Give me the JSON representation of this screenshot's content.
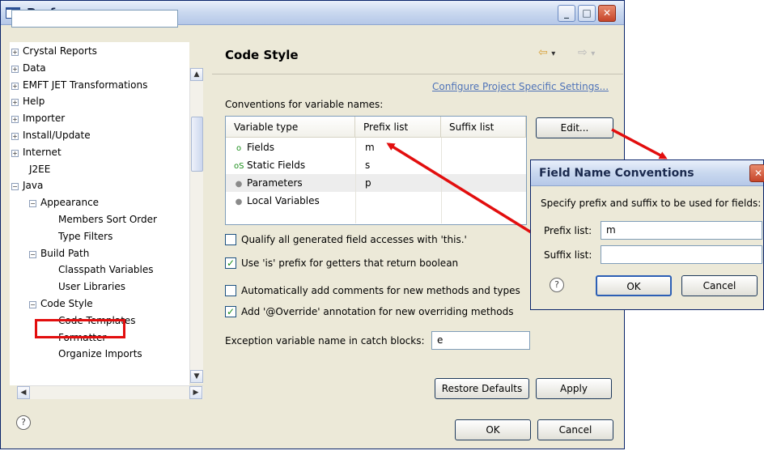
{
  "window": {
    "title": "Preferences",
    "min_label": "_",
    "max_label": "□",
    "close_label": "✕"
  },
  "tree": {
    "items": [
      {
        "label": "Crystal Reports",
        "expander": "+"
      },
      {
        "label": "Data",
        "expander": "+"
      },
      {
        "label": "EMFT JET Transformations",
        "expander": "+"
      },
      {
        "label": "Help",
        "expander": "+"
      },
      {
        "label": "Importer",
        "expander": "+"
      },
      {
        "label": "Install/Update",
        "expander": "+"
      },
      {
        "label": "Internet",
        "expander": "+"
      },
      {
        "label": "J2EE",
        "expander": ""
      },
      {
        "label": "Java",
        "expander": "−"
      },
      {
        "label": "Appearance",
        "expander": "−"
      },
      {
        "label": "Members Sort Order",
        "expander": ""
      },
      {
        "label": "Type Filters",
        "expander": ""
      },
      {
        "label": "Build Path",
        "expander": "−"
      },
      {
        "label": "Classpath Variables",
        "expander": ""
      },
      {
        "label": "User Libraries",
        "expander": ""
      },
      {
        "label": "Code Style",
        "expander": "−"
      },
      {
        "label": "Code Templates",
        "expander": ""
      },
      {
        "label": "Formatter",
        "expander": ""
      },
      {
        "label": "Organize Imports",
        "expander": ""
      }
    ]
  },
  "page": {
    "title": "Code Style",
    "back_icon": "⇦",
    "dropdown_icon": "▾",
    "forward_icon": "⇨",
    "configure_link": "Configure Project Specific Settings...",
    "conventions_label": "Conventions for variable names:",
    "table": {
      "headers": [
        "Variable type",
        "Prefix list",
        "Suffix list"
      ],
      "rows": [
        {
          "icon": "o",
          "icon_color": "#1a8e1a",
          "type": "Fields",
          "prefix": "m",
          "suffix": ""
        },
        {
          "icon": "oS",
          "icon_color": "#1a8e1a",
          "type": "Static Fields",
          "prefix": "s",
          "suffix": ""
        },
        {
          "icon": "●",
          "icon_color": "#8a8a8a",
          "type": "Parameters",
          "prefix": "p",
          "suffix": ""
        },
        {
          "icon": "●",
          "icon_color": "#8a8a8a",
          "type": "Local Variables",
          "prefix": "",
          "suffix": ""
        }
      ]
    },
    "edit_button": "Edit...",
    "options": [
      {
        "label": "Qualify all generated field accesses with 'this.'",
        "checked": false
      },
      {
        "label": "Use 'is' prefix for getters that return boolean",
        "checked": true
      },
      {
        "label": "Automatically add comments for new methods and types",
        "checked": false
      },
      {
        "label": "Add '@Override' annotation for new overriding methods",
        "checked": true
      }
    ],
    "exception_label": "Exception variable name in catch blocks:",
    "exception_value": "e",
    "restore_defaults": "Restore Defaults",
    "apply": "Apply"
  },
  "footer": {
    "help_icon": "?",
    "ok": "OK",
    "cancel": "Cancel"
  },
  "dialog": {
    "title": "Field Name Conventions",
    "close_label": "✕",
    "description": "Specify prefix and suffix to be used for fields:",
    "prefix_label": "Prefix list:",
    "prefix_value": "m",
    "suffix_label": "Suffix list:",
    "suffix_value": "",
    "help_icon": "?",
    "ok": "OK",
    "cancel": "Cancel"
  },
  "colors": {
    "annotation_red": "#e20e0e",
    "link_blue": "#4f73b8"
  }
}
